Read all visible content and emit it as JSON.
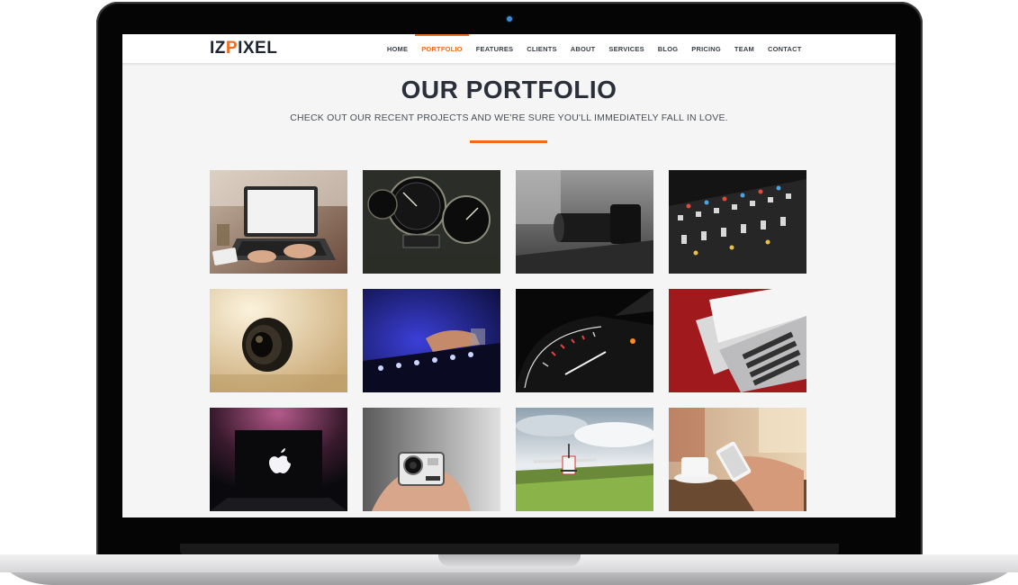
{
  "site": {
    "logo_part1": "IZ",
    "logo_part2": "P",
    "logo_part3": "IXEL"
  },
  "nav": {
    "items": [
      "HOME",
      "PORTFOLIO",
      "FEATURES",
      "CLIENTS",
      "ABOUT",
      "SERVICES",
      "BLOG",
      "PRICING",
      "TEAM",
      "CONTACT"
    ],
    "active": "PORTFOLIO"
  },
  "portfolio": {
    "title": "OUR PORTFOLIO",
    "subtitle": "CHECK OUT OUR RECENT PROJECTS AND WE'RE SURE YOU'LL IMMEDIATELY FALL IN LOVE.",
    "accent_color": "#f26b1d",
    "tiles": [
      {
        "icon": "laptop-typing-photo"
      },
      {
        "icon": "car-gauges-photo"
      },
      {
        "icon": "camera-lens-photo"
      },
      {
        "icon": "audio-mixer-photo"
      },
      {
        "icon": "lens-closeup-photo"
      },
      {
        "icon": "dj-mixer-photo"
      },
      {
        "icon": "speedometer-photo"
      },
      {
        "icon": "laptop-keyboard-photo"
      },
      {
        "icon": "macbook-apple-photo"
      },
      {
        "icon": "action-camera-photo"
      },
      {
        "icon": "airplane-field-photo"
      },
      {
        "icon": "smartphone-cafe-photo"
      }
    ]
  }
}
